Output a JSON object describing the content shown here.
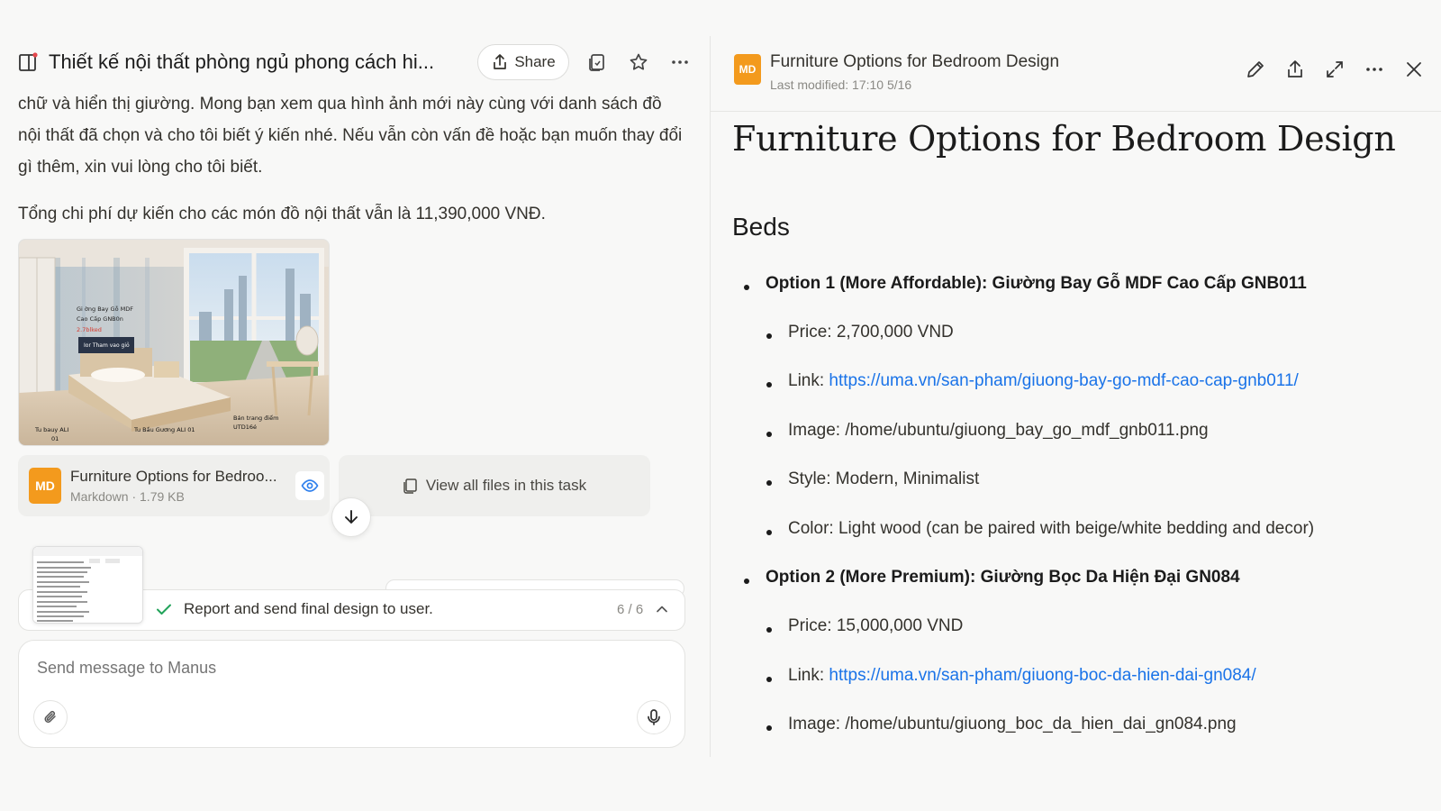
{
  "chat": {
    "title": "Thiết kế nội thất phòng ngủ phong cách hi...",
    "share_label": "Share",
    "message_paragraph": "chữ và hiển thị giường. Mong bạn xem qua hình ảnh mới này cùng với danh sách đồ nội thất đã chọn và cho tôi biết ý kiến nhé. Nếu vẫn còn vấn đề hoặc bạn muốn thay đổi gì thêm, xin vui lòng cho tôi biết.",
    "total_cost": "Tổng chi phí dự kiến cho các món đồ nội thất vẫn là 11,390,000 VNĐ.",
    "image_labels": {
      "bed_label_1": "Gi ờng Bay Gỗ MDF",
      "bed_label_2": "Cao Cấp GNB0n",
      "bed_label_3": "2.7blked",
      "button_text": "Ior Tham vao giỏ",
      "wardrobe": "Tu bauy ALI",
      "wardrobe_2": "01",
      "nightstand": "Tu Bầu Gương ALI 01",
      "desk": "Bán trang điểm",
      "desk_2": "UTD16é"
    },
    "file_card": {
      "badge": "MD",
      "name": "Furniture Options for Bedroo...",
      "meta": "Markdown · 1.79 KB"
    },
    "view_all_label": "View all files in this task",
    "task": {
      "text": "Report and send final design to user.",
      "count": "6 / 6"
    },
    "composer_placeholder": "Send message to Manus"
  },
  "doc": {
    "header_badge": "MD",
    "header_title": "Furniture Options for Bedroom Design",
    "header_meta": "Last modified: 17:10 5/16",
    "h1": "Furniture Options for Bedroom Design",
    "section": "Beds",
    "options": [
      {
        "title": "Option 1 (More Affordable): Giường Bay Gỗ MDF Cao Cấp GNB011",
        "price": "Price: 2,700,000 VND",
        "link_prefix": "Link: ",
        "link": "https://uma.vn/san-pham/giuong-bay-go-mdf-cao-cap-gnb011/",
        "image": "Image: /home/ubuntu/giuong_bay_go_mdf_gnb011.png",
        "style": "Style: Modern, Minimalist",
        "color": "Color: Light wood (can be paired with beige/white bedding and decor)"
      },
      {
        "title": "Option 2 (More Premium): Giường Bọc Da Hiện Đại GN084",
        "price": "Price: 15,000,000 VND",
        "link_prefix": "Link: ",
        "link": "https://uma.vn/san-pham/giuong-boc-da-hien-dai-gn084/",
        "image": "Image: /home/ubuntu/giuong_boc_da_hien_dai_gn084.png"
      }
    ]
  },
  "colors": {
    "accent_orange": "#f39a1d",
    "link_blue": "#1a73e8",
    "check_green": "#22a35a",
    "eye_blue": "#2f80ed"
  },
  "icons": [
    "panel-icon",
    "share-icon",
    "file-copy-icon",
    "star-icon",
    "more-icon",
    "eye-icon",
    "files-icon",
    "arrow-down-icon",
    "check-icon",
    "chevron-up-icon",
    "paperclip-icon",
    "mic-icon",
    "pencil-icon",
    "export-icon",
    "expand-icon",
    "close-icon"
  ]
}
